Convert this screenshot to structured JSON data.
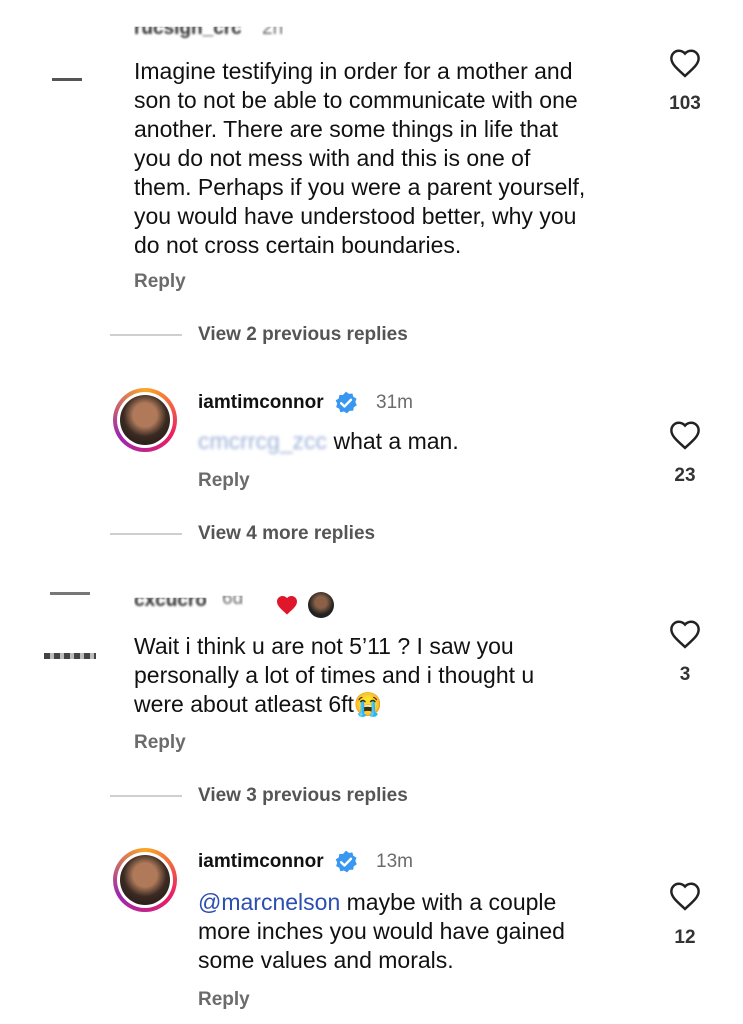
{
  "comments": [
    {
      "user_partial": "rucsign_crc",
      "time_partial": "2h",
      "text": "Imagine testifying in order for a mother and son to not be able to communicate with one another. There are some things in life that you do not mess with and this is one of them. Perhaps if you were a parent yourself, you would have understood better, why you do not cross certain boundaries.",
      "lines": [
        "Imagine testifying in order for a mother and",
        "son to not be able to communicate with one",
        "another. There are some things in life that",
        "you do not mess with and this is one of",
        "them. Perhaps if you were a parent yourself,",
        "you would have understood better, why you",
        "do not cross certain boundaries."
      ],
      "likes": "103",
      "reply_label": "Reply"
    },
    {
      "user_partial": "cxcucro",
      "time_partial": "6d",
      "lines": [
        "Wait i think u are not 5’11 ? I saw you",
        "personally a lot of times and i thought u",
        "were about atleast 6ft😭"
      ],
      "likes": "3",
      "reply_label": "Reply"
    }
  ],
  "threads": {
    "view_prev_1": "View 2 previous replies",
    "view_more": "View 4 more replies",
    "view_prev_2": "View 3 previous replies"
  },
  "replies": [
    {
      "username": "iamtimconnor",
      "time": "31m",
      "mention_blurred": "cmcrrcg_zcc",
      "text": "what a man.",
      "likes": "23",
      "reply_label": "Reply"
    },
    {
      "username": "iamtimconnor",
      "time": "13m",
      "mention": "@marcnelson",
      "line1_rest": " maybe with a couple",
      "line2": "more inches you would have gained",
      "line3": "some values and morals.",
      "likes": "12",
      "reply_label": "Reply"
    }
  ],
  "colors": {
    "mention": "#2b4eb0",
    "verified": "#3897f0",
    "heart_red": "#e0162b"
  }
}
